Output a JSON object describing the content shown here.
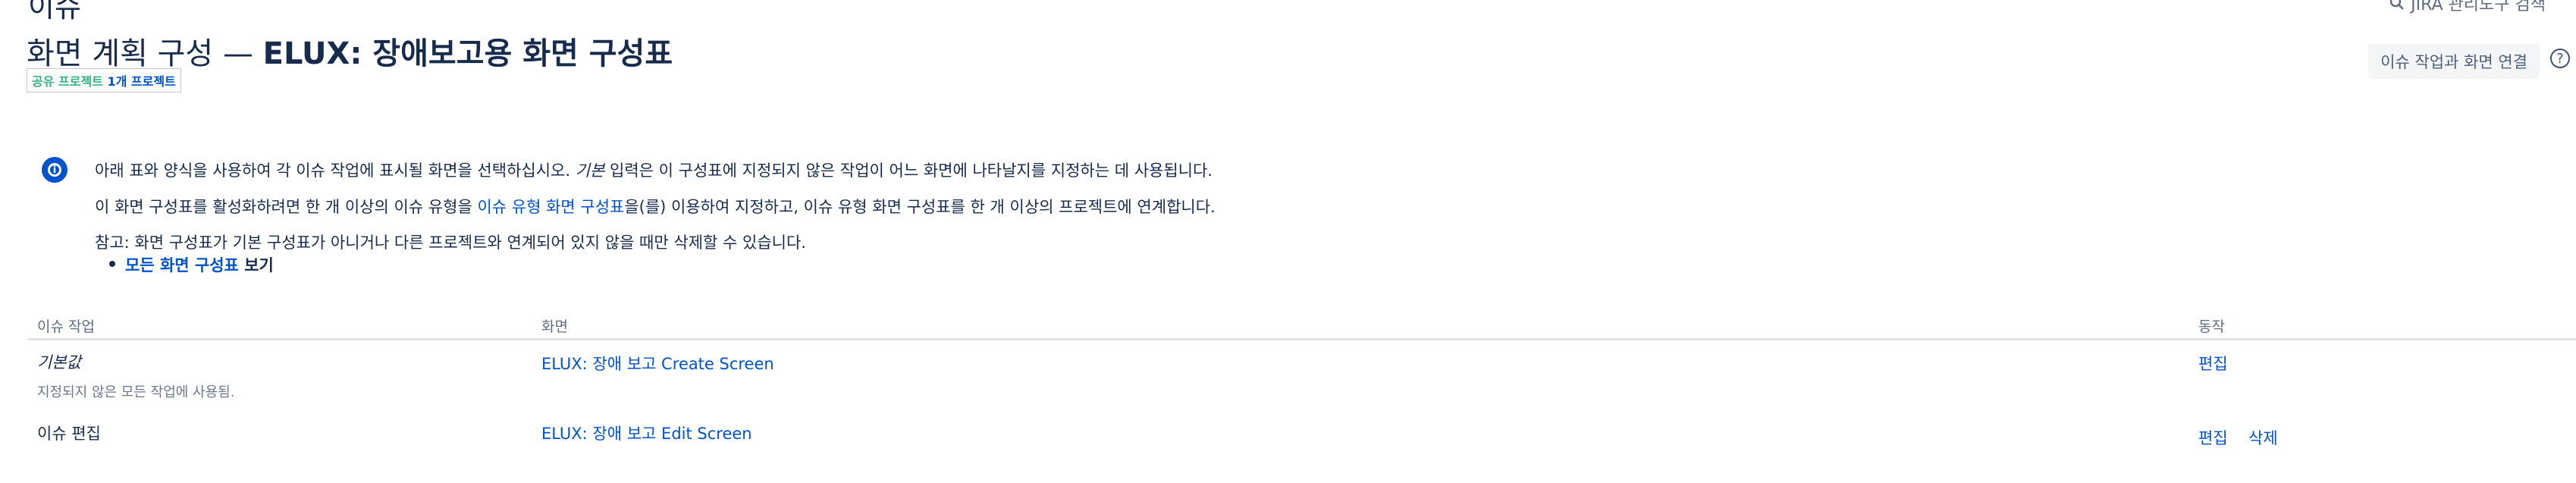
{
  "header": {
    "heading": "이슈",
    "search_placeholder": "JIRA 관리도구 검색"
  },
  "page": {
    "title_prefix": "화면 계획 구성 — ",
    "title_scheme": "ELUX: 장애보고용 화면 구성표",
    "shared_label": "공유 프로젝트",
    "shared_count": "1개 프로젝트",
    "associate_button": "이슈 작업과 화면 연결"
  },
  "info": {
    "line1_a": "아래 표와 양식을 사용하여 각 이슈 작업에 표시될 화면을 선택하십시오. ",
    "line1_em": "기본",
    "line1_b": " 입력은 이 구성표에 지정되지 않은 작업이 어느 화면에 나타날지를 지정하는 데 사용됩니다.",
    "line2_a": "이 화면 구성표를 활성화하려면 한 개 이상의 이슈 유형을 ",
    "line2_link": "이슈 유형 화면 구성표",
    "line2_b": "을(를) 이용하여 지정하고, 이슈 유형 화면 구성표를 한 개 이상의 프로젝트에 연계합니다.",
    "line3": "참고: 화면 구성표가 기본 구성표가 아니거나 다른 프로젝트와 연계되어 있지 않을 때만 삭제할 수 있습니다.",
    "bullet_link": "모든 화면 구성표",
    "bullet_suffix": " 보기"
  },
  "table": {
    "headers": [
      "이슈 작업",
      "화면",
      "동작"
    ],
    "rows": [
      {
        "operation": "기본값",
        "note": "지정되지 않은 모든 작업에 사용됨.",
        "screen": "ELUX: 장애 보고 Create Screen",
        "actions": [
          "편집"
        ]
      },
      {
        "operation": "이슈 편집",
        "screen": "ELUX: 장애 보고 Edit Screen",
        "actions": [
          "편집",
          "삭제"
        ]
      }
    ]
  },
  "colors": {
    "link": "#0052cc",
    "text": "#172b4d",
    "muted": "#6b778c",
    "shared_green": "#36b37e",
    "info_blue": "#0052cc"
  }
}
